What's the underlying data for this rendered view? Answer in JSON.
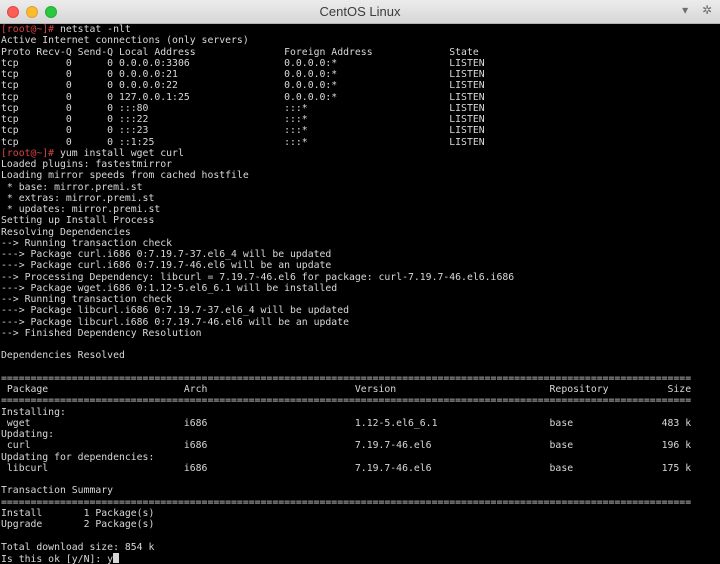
{
  "window": {
    "title": "CentOS Linux",
    "controls": [
      "close",
      "minimize",
      "maximize"
    ],
    "title_icons": {
      "dropdown": "▾",
      "settings": "✲"
    }
  },
  "terminal": {
    "colors": {
      "background": "#000000",
      "text": "#d8d8d8",
      "prompt": "#d94545"
    },
    "prompt": "[root@~]# ",
    "command_1": "netstat -nlt",
    "netstat_output": "Active Internet connections (only servers)\nProto Recv-Q Send-Q Local Address               Foreign Address             State\ntcp        0      0 0.0.0.0:3306                0.0.0.0:*                   LISTEN\ntcp        0      0 0.0.0.0:21                  0.0.0.0:*                   LISTEN\ntcp        0      0 0.0.0.0:22                  0.0.0.0:*                   LISTEN\ntcp        0      0 127.0.0.1:25                0.0.0.0:*                   LISTEN\ntcp        0      0 :::80                       :::*                        LISTEN\ntcp        0      0 :::22                       :::*                        LISTEN\ntcp        0      0 :::23                       :::*                        LISTEN\ntcp        0      0 ::1:25                      :::*                        LISTEN",
    "command_2": "yum install wget curl",
    "yum_output": "Loaded plugins: fastestmirror\nLoading mirror speeds from cached hostfile\n * base: mirror.premi.st\n * extras: mirror.premi.st\n * updates: mirror.premi.st\nSetting up Install Process\nResolving Dependencies\n--> Running transaction check\n---> Package curl.i686 0:7.19.7-37.el6_4 will be updated\n---> Package curl.i686 0:7.19.7-46.el6 will be an update\n--> Processing Dependency: libcurl = 7.19.7-46.el6 for package: curl-7.19.7-46.el6.i686\n---> Package wget.i686 0:1.12-5.el6_6.1 will be installed\n--> Running transaction check\n---> Package libcurl.i686 0:7.19.7-37.el6_4 will be updated\n---> Package libcurl.i686 0:7.19.7-46.el6 will be an update\n--> Finished Dependency Resolution\n\nDependencies Resolved\n\n=====================================================================================================================\n Package                       Arch                         Version                          Repository          Size\n=====================================================================================================================\nInstalling:\n wget                          i686                         1.12-5.el6_6.1                   base               483 k\nUpdating:\n curl                          i686                         7.19.7-46.el6                    base               196 k\nUpdating for dependencies:\n libcurl                       i686                         7.19.7-46.el6                    base               175 k\n\nTransaction Summary\n=====================================================================================================================\nInstall       1 Package(s)\nUpgrade       2 Package(s)\n\nTotal download size: 854 k\nIs this ok [y/N]: y"
  }
}
